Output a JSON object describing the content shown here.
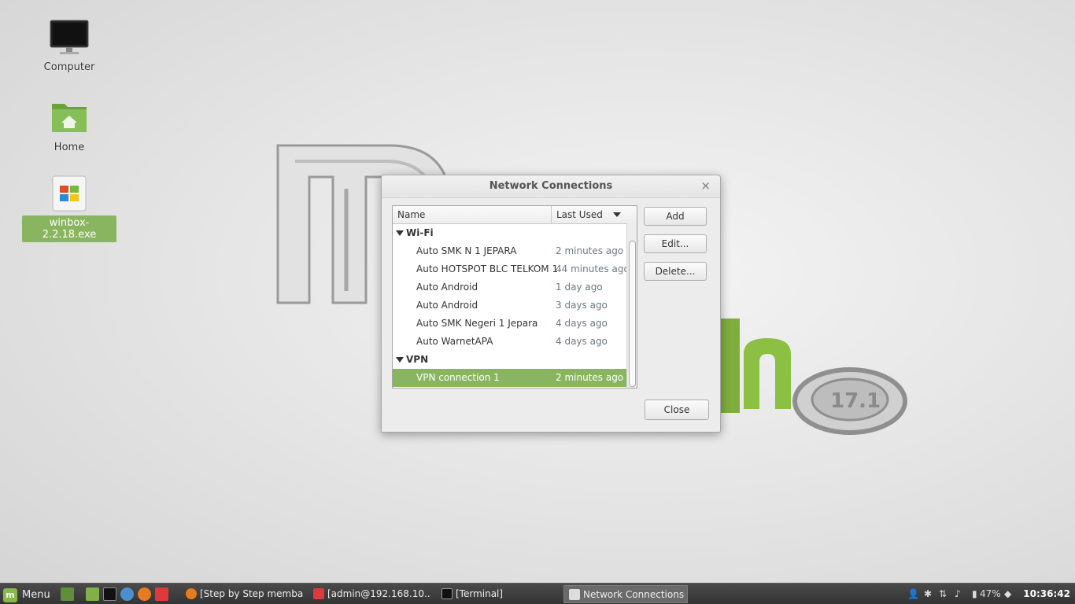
{
  "desktop": {
    "icons": [
      {
        "label": "Computer"
      },
      {
        "label": "Home"
      },
      {
        "label": "winbox-2.2.18.exe"
      }
    ]
  },
  "dialog": {
    "title": "Network Connections",
    "columns": {
      "name": "Name",
      "last_used": "Last Used"
    },
    "groups": [
      {
        "label": "Wi-Fi",
        "items": [
          {
            "name": "Auto SMK N 1 JEPARA",
            "last_used": "2 minutes ago"
          },
          {
            "name": "Auto HOTSPOT BLC TELKOM 1",
            "last_used": "44 minutes ago"
          },
          {
            "name": "Auto Android",
            "last_used": "1 day ago"
          },
          {
            "name": "Auto Android",
            "last_used": "3 days ago"
          },
          {
            "name": "Auto SMK Negeri 1 Jepara",
            "last_used": "4 days ago"
          },
          {
            "name": "Auto WarnetAPA",
            "last_used": "4 days ago"
          }
        ]
      },
      {
        "label": "VPN",
        "items": [
          {
            "name": "VPN connection 1",
            "last_used": "2 minutes ago",
            "selected": true
          }
        ]
      }
    ],
    "buttons": {
      "add": "Add",
      "edit": "Edit...",
      "delete": "Delete...",
      "close": "Close"
    },
    "close_glyph": "×"
  },
  "taskbar": {
    "menu_label": "Menu",
    "tasks": [
      {
        "label": "[Step by Step memba..."
      },
      {
        "label": "[admin@192.168.10...."
      },
      {
        "label": "[Terminal]"
      },
      {
        "label": "Network Connections"
      }
    ],
    "battery": "47%",
    "clock": "10:36:42"
  },
  "colors": {
    "selection": "#8ab560",
    "mint_green": "#87b84a",
    "taskbar": "#3a3a3a"
  }
}
